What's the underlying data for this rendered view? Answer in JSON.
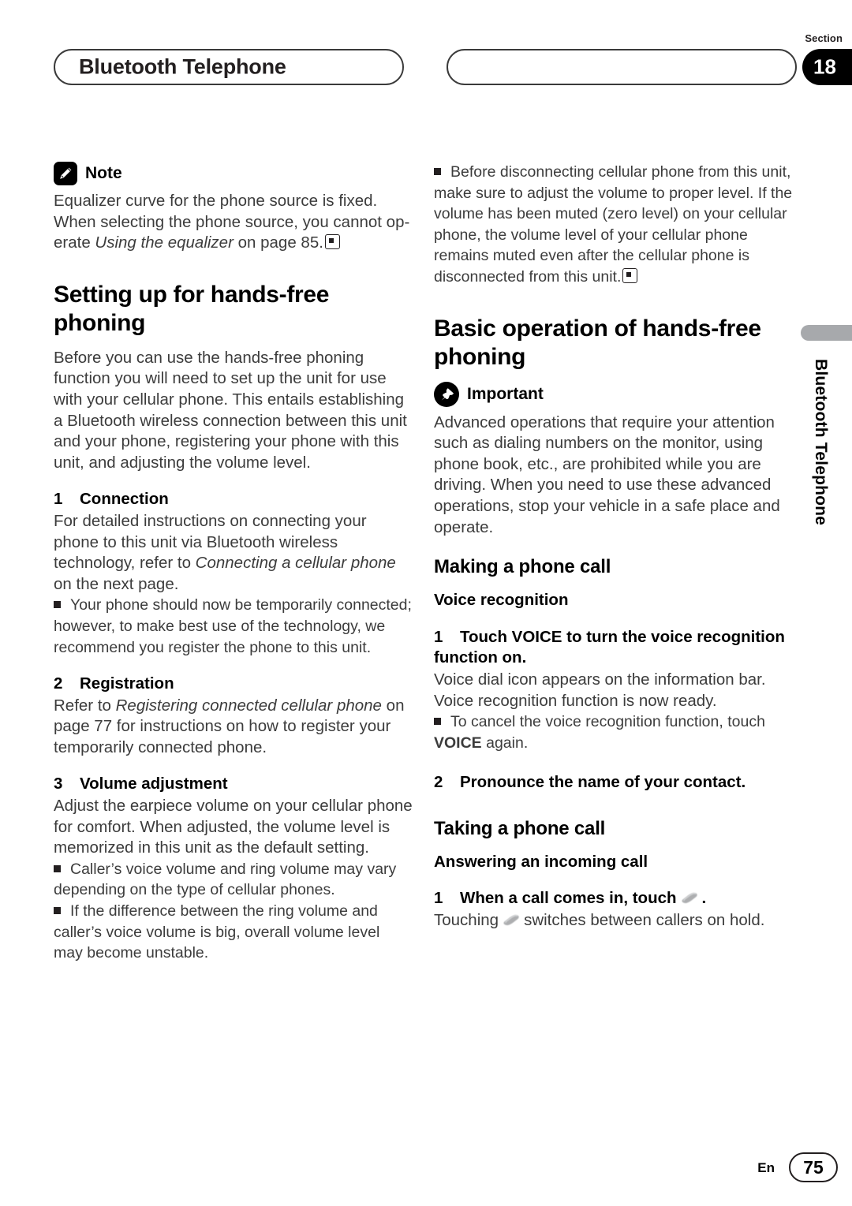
{
  "header": {
    "title": "Bluetooth Telephone",
    "section_word": "Section",
    "section_number": "18"
  },
  "edge_tab": {
    "label": "Bluetooth Telephone"
  },
  "footer": {
    "language": "En",
    "page_number": "75"
  },
  "left_column": {
    "note": {
      "icon": "pencil-icon",
      "label": "Note",
      "line1": "Equalizer curve for the phone source is fixed.",
      "line2a": "When selecting the phone source, you cannot op-erate ",
      "italic": "Using the equalizer",
      "line2b": " on page 85."
    },
    "heading_setting_up": "Setting up for hands-free phoning",
    "intro": "Before you can use the hands-free phoning function you will need to set up the unit for use with your cellular phone. This entails establishing a Bluetooth wireless connection between this unit and your phone, registering your phone with this unit, and adjusting the volume level.",
    "step1": {
      "num": "1",
      "title": "Connection",
      "body_a": "For detailed instructions on connecting your phone to this unit via Bluetooth wireless technology, refer to ",
      "italic": "Connecting a cellular phone",
      "body_b": " on the next page.",
      "bullet": "Your phone should now be temporarily connected; however, to make best use of the technology, we recommend you register the phone to this unit."
    },
    "step2": {
      "num": "2",
      "title": "Registration",
      "body_a": "Refer to ",
      "italic": "Registering connected cellular phone",
      "body_b": " on page 77 for instructions on how to register your temporarily connected phone."
    },
    "step3": {
      "num": "3",
      "title": "Volume adjustment",
      "body": "Adjust the earpiece volume on your cellular phone for comfort. When adjusted, the volume level is memorized in this unit as the default setting.",
      "bullet1": "Caller’s voice volume and ring volume may vary depending on the type of cellular phones.",
      "bullet2": "If the difference between the ring volume and caller’s voice volume is big, overall volume level may become unstable."
    }
  },
  "right_column": {
    "top_bullet": "Before disconnecting cellular phone from this unit, make sure to adjust the volume to proper level. If the volume has been muted (zero level) on your cellular phone, the volume level of your cellular phone remains muted even after the cellular phone is disconnected from this unit.",
    "heading_basic_operation": "Basic operation of hands-free phoning",
    "important": {
      "icon": "pushpin-icon",
      "label": "Important",
      "body": "Advanced operations that require your attention such as dialing numbers on the monitor, using phone book, etc., are prohibited while you are driving. When you need to use these advanced operations, stop your vehicle in a safe place and operate."
    },
    "heading_making_call": "Making a phone call",
    "subheading_voice": "Voice recognition",
    "voice_step1": {
      "num": "1",
      "title": "Touch VOICE to turn the voice recognition function on.",
      "body": "Voice dial icon appears on the information bar. Voice recognition function is now ready.",
      "bullet_a": "To cancel the voice recognition function, touch ",
      "bullet_bold": "VOICE",
      "bullet_b": " again."
    },
    "voice_step2": {
      "num": "2",
      "title": "Pronounce the name of your contact."
    },
    "heading_taking_call": "Taking a phone call",
    "subheading_answering": "Answering an incoming call",
    "answer_step1": {
      "num": "1",
      "title_a": "When a call comes in, touch",
      "icon": "phone-handset-icon",
      "title_b": ".",
      "body_a": "Touching",
      "body_b": "switches between callers on hold."
    }
  }
}
